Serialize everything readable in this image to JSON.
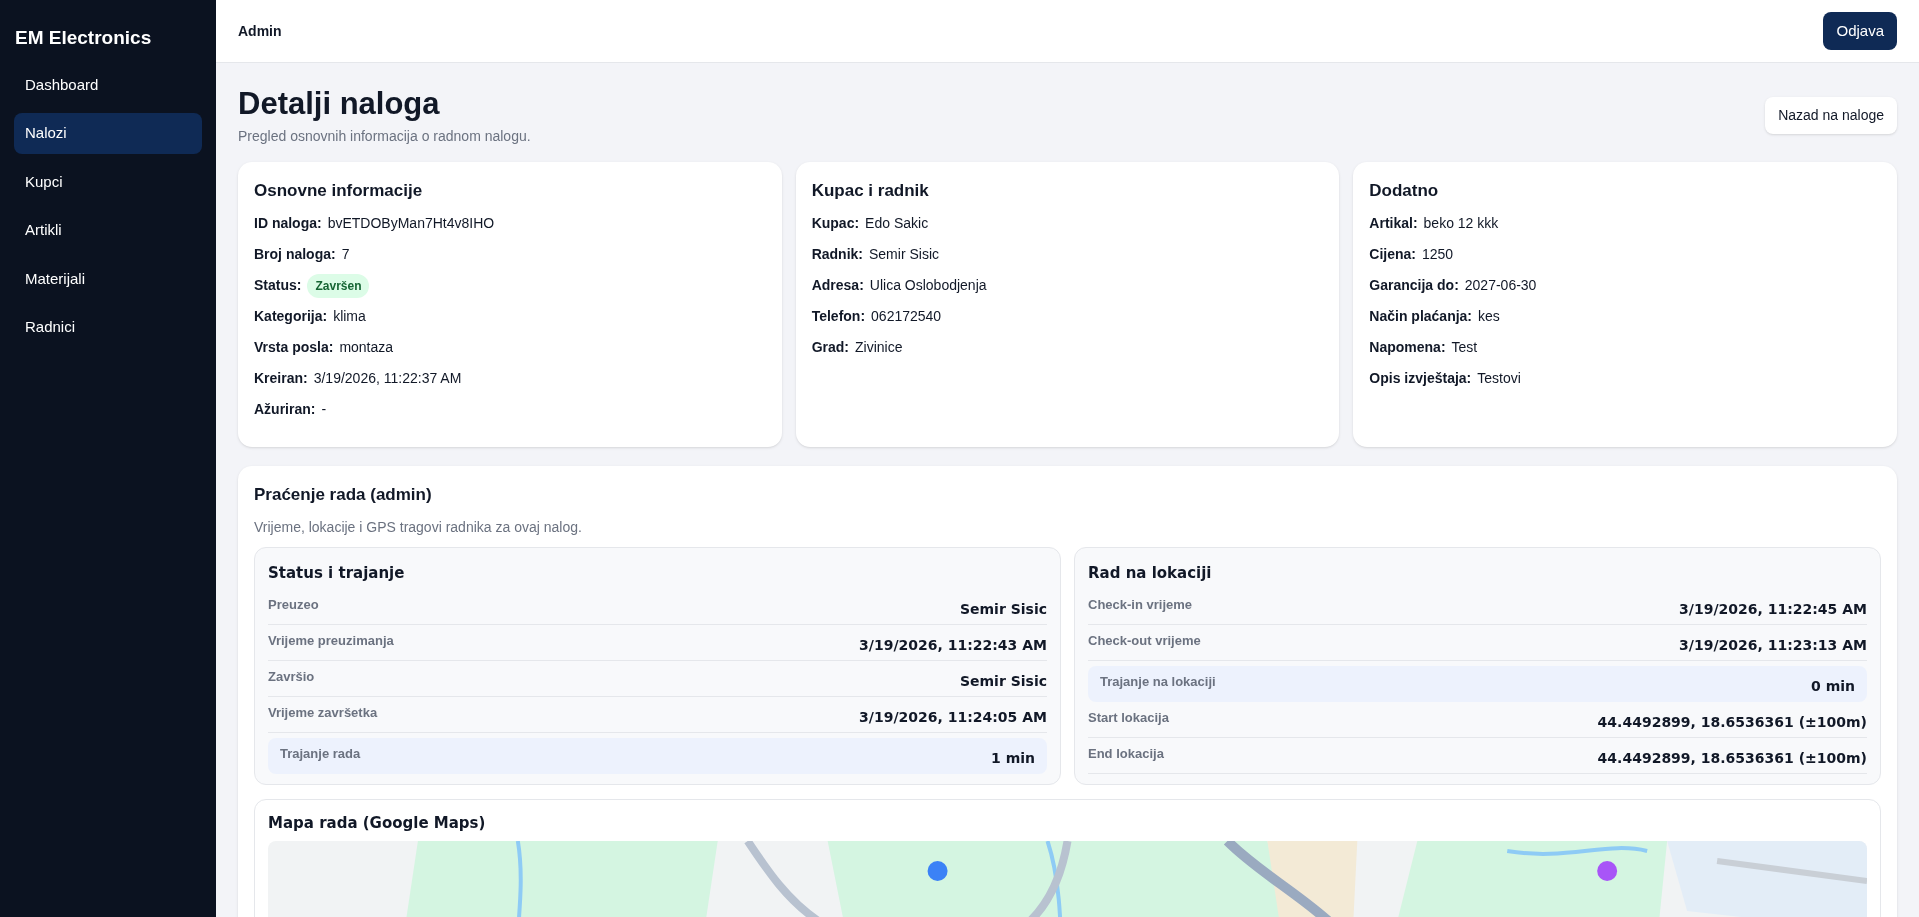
{
  "sidebar": {
    "brand": "EM Electronics",
    "items": [
      {
        "label": "Dashboard",
        "selected": false
      },
      {
        "label": "Nalozi",
        "selected": true
      },
      {
        "label": "Kupci",
        "selected": false
      },
      {
        "label": "Artikli",
        "selected": false
      },
      {
        "label": "Materijali",
        "selected": false
      },
      {
        "label": "Radnici",
        "selected": false
      }
    ]
  },
  "header": {
    "user": "Admin",
    "logout": "Odjava"
  },
  "page": {
    "title": "Detalji naloga",
    "subtitle": "Pregled osnovnih informacija o radnom nalogu.",
    "back": "Nazad na naloge"
  },
  "cards": [
    {
      "title": "Osnovne informacije",
      "fields": [
        {
          "label": "ID naloga:",
          "value": "bvETDOByMan7Ht4v8IHO",
          "kind": "text"
        },
        {
          "label": "Broj naloga:",
          "value": "7",
          "kind": "text"
        },
        {
          "label": "Status:",
          "value": "Završen",
          "kind": "badge"
        },
        {
          "label": "Kategorija:",
          "value": "klima",
          "kind": "text"
        },
        {
          "label": "Vrsta posla:",
          "value": "montaza",
          "kind": "text"
        },
        {
          "label": "Kreiran:",
          "value": "3/19/2026, 11:22:37 AM",
          "kind": "text"
        },
        {
          "label": "Ažuriran:",
          "value": "-",
          "kind": "text"
        }
      ]
    },
    {
      "title": "Kupac i radnik",
      "fields": [
        {
          "label": "Kupac:",
          "value": "Edo Sakic",
          "kind": "text"
        },
        {
          "label": "Radnik:",
          "value": "Semir Sisic",
          "kind": "text"
        },
        {
          "label": "Adresa:",
          "value": "Ulica Oslobodjenja",
          "kind": "text"
        },
        {
          "label": "Telefon:",
          "value": "062172540",
          "kind": "text"
        },
        {
          "label": "Grad:",
          "value": "Zivinice",
          "kind": "text"
        }
      ]
    },
    {
      "title": "Dodatno",
      "fields": [
        {
          "label": "Artikal:",
          "value": "beko 12 kkk",
          "kind": "text"
        },
        {
          "label": "Cijena:",
          "value": "1250",
          "kind": "text"
        },
        {
          "label": "Garancija do:",
          "value": "2027-06-30",
          "kind": "text"
        },
        {
          "label": "Način plaćanja:",
          "value": "kes",
          "kind": "text"
        },
        {
          "label": "Napomena:",
          "value": "Test",
          "kind": "text"
        },
        {
          "label": "Opis izvještaja:",
          "value": "Testovi",
          "kind": "text"
        }
      ]
    }
  ],
  "tracking": {
    "title": "Praćenje rada (admin)",
    "subtitle": "Vrijeme, lokacije i GPS tragovi radnika za ovaj nalog.",
    "panels": [
      {
        "title": "Status i trajanje",
        "rows": [
          {
            "label": "Preuzeo",
            "value": "Semir Sisic",
            "highlight": false
          },
          {
            "label": "Vrijeme preuzimanja",
            "value": "3/19/2026, 11:22:43 AM",
            "highlight": false
          },
          {
            "label": "Završio",
            "value": "Semir Sisic",
            "highlight": false
          },
          {
            "label": "Vrijeme završetka",
            "value": "3/19/2026, 11:24:05 AM",
            "highlight": false
          },
          {
            "label": "Trajanje rada",
            "value": "1 min",
            "highlight": true
          }
        ]
      },
      {
        "title": "Rad na lokaciji",
        "rows": [
          {
            "label": "Check-in vrijeme",
            "value": "3/19/2026, 11:22:45 AM",
            "highlight": false
          },
          {
            "label": "Check-out vrijeme",
            "value": "3/19/2026, 11:23:13 AM",
            "highlight": false
          },
          {
            "label": "Trajanje na lokaciji",
            "value": "0 min",
            "highlight": true
          },
          {
            "label": "Start lokacija",
            "value": "44.4492899, 18.6536361 (±100m)",
            "highlight": false
          },
          {
            "label": "End lokacija",
            "value": "44.4492899, 18.6536361 (±100m)",
            "highlight": false
          }
        ]
      }
    ],
    "map": {
      "title": "Mapa rada (Google Maps)",
      "kind": "picture"
    }
  }
}
